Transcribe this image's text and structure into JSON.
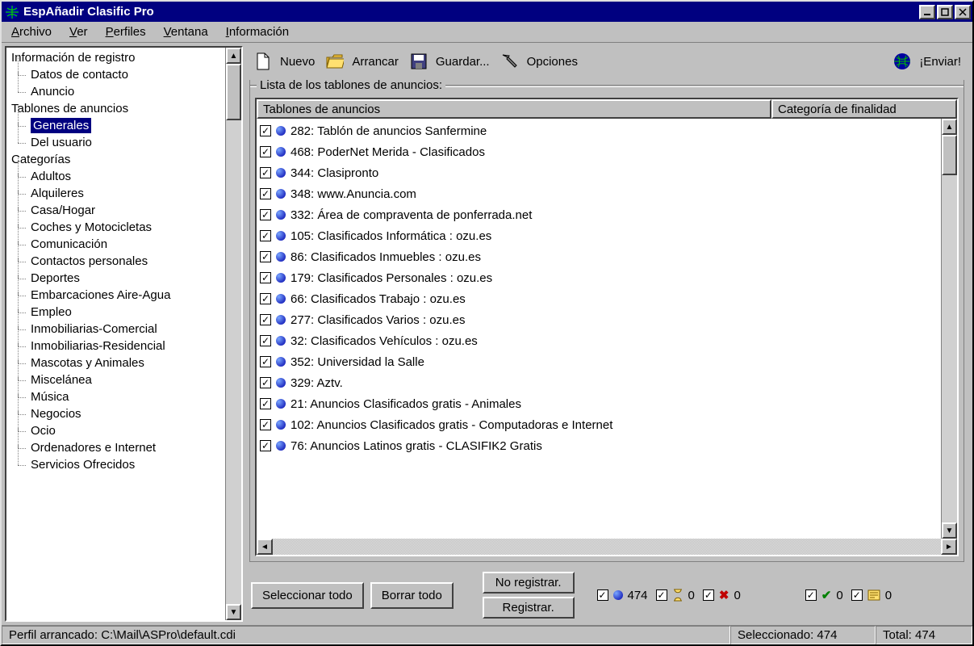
{
  "app": {
    "title": "EspAñadir Clasific Pro"
  },
  "menu": {
    "archivo": "Archivo",
    "ver": "Ver",
    "perfiles": "Perfiles",
    "ventana": "Ventana",
    "informacion": "Información"
  },
  "toolbar": {
    "nuevo": "Nuevo",
    "arrancar": "Arrancar",
    "guardar": "Guardar...",
    "opciones": "Opciones",
    "enviar": "¡Enviar!"
  },
  "sidebar": {
    "info_registro": "Información de registro",
    "info_children": [
      "Datos de contacto",
      "Anuncio"
    ],
    "tablones": "Tablones de anuncios",
    "tablones_children": [
      "Generales",
      "Del usuario"
    ],
    "categorias": "Categorías",
    "categorias_children": [
      "Adultos",
      "Alquileres",
      "Casa/Hogar",
      "Coches y Motocicletas",
      "Comunicación",
      "Contactos personales",
      "Deportes",
      "Embarcaciones Aire-Agua",
      "Empleo",
      "Inmobiliarias-Comercial",
      "Inmobiliarias-Residencial",
      "Mascotas y Animales",
      "Miscelánea",
      "Música",
      "Negocios",
      "Ocio",
      "Ordenadores e Internet",
      "Servicios Ofrecidos"
    ],
    "selected": "Generales"
  },
  "list": {
    "group_label": "Lista de los tablones de anuncios:",
    "col1": "Tablones de anuncios",
    "col2": "Categoría de finalidad",
    "rows": [
      "282: Tablón de anuncios Sanfermine",
      "468: PoderNet Merida - Clasificados",
      "344: Clasipronto",
      "348: www.Anuncia.com",
      "332: Área de compraventa de ponferrada.net",
      "105: Clasificados Informática : ozu.es",
      "86: Clasificados Inmuebles : ozu.es",
      "179: Clasificados Personales : ozu.es",
      "66: Clasificados Trabajo : ozu.es",
      "277: Clasificados Varios : ozu.es",
      "32: Clasificados Vehículos : ozu.es",
      "352: Universidad la Salle",
      "329: Aztv.",
      "21: Anuncios Clasificados gratis - Animales",
      "102: Anuncios Clasificados gratis - Computadoras e Internet",
      "76: Anuncios Latinos gratis - CLASIFIK2 Gratis"
    ]
  },
  "bottom": {
    "seleccionar": "Seleccionar todo",
    "borrar": "Borrar todo",
    "no_registrar": "No registrar.",
    "registrar": "Registrar.",
    "stat_blue": "474",
    "stat_hourglass": "0",
    "stat_red": "0",
    "stat_green": "0",
    "stat_newspaper": "0"
  },
  "status": {
    "profile": "Perfil arrancado: C:\\Mail\\ASPro\\default.cdi",
    "seleccionado": "Seleccionado: 474",
    "total": "Total: 474"
  }
}
